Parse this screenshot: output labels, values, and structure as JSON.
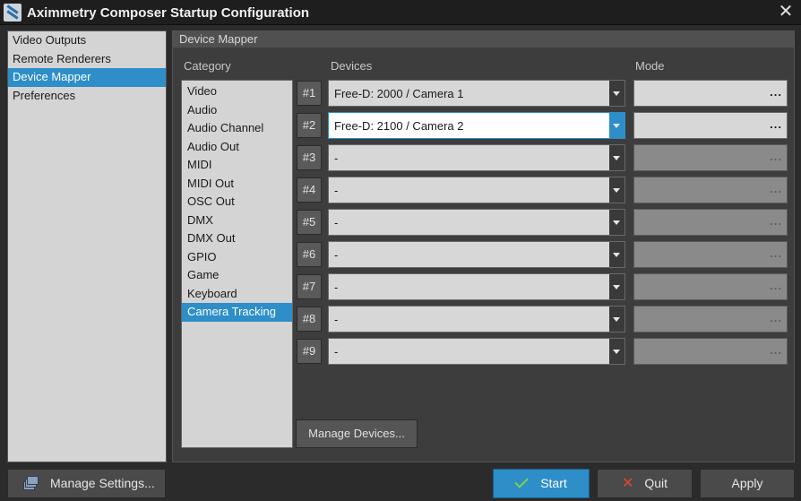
{
  "window": {
    "title": "Aximmetry Composer Startup Configuration"
  },
  "nav": {
    "items": [
      {
        "label": "Video Outputs",
        "selected": false
      },
      {
        "label": "Remote Renderers",
        "selected": false
      },
      {
        "label": "Device Mapper",
        "selected": true
      },
      {
        "label": "Preferences",
        "selected": false
      }
    ]
  },
  "panel": {
    "title": "Device Mapper",
    "category_header": "Category",
    "devices_header": "Devices",
    "mode_header": "Mode",
    "categories": [
      {
        "label": "Video",
        "selected": false
      },
      {
        "label": "Audio",
        "selected": false
      },
      {
        "label": "Audio Channel",
        "selected": false
      },
      {
        "label": "Audio Out",
        "selected": false
      },
      {
        "label": "MIDI",
        "selected": false
      },
      {
        "label": "MIDI Out",
        "selected": false
      },
      {
        "label": "OSC Out",
        "selected": false
      },
      {
        "label": "DMX",
        "selected": false
      },
      {
        "label": "DMX Out",
        "selected": false
      },
      {
        "label": "GPIO",
        "selected": false
      },
      {
        "label": "Game",
        "selected": false
      },
      {
        "label": "Keyboard",
        "selected": false
      },
      {
        "label": "Camera Tracking",
        "selected": true
      }
    ],
    "devices": [
      {
        "num": "#1",
        "value": "Free-D: 2000 / Camera 1",
        "mode": "...",
        "mode_enabled": true,
        "active": false
      },
      {
        "num": "#2",
        "value": "Free-D: 2100 / Camera 2",
        "mode": "...",
        "mode_enabled": true,
        "active": true
      },
      {
        "num": "#3",
        "value": "-",
        "mode": "...",
        "mode_enabled": false,
        "active": false
      },
      {
        "num": "#4",
        "value": "-",
        "mode": "...",
        "mode_enabled": false,
        "active": false
      },
      {
        "num": "#5",
        "value": "-",
        "mode": "...",
        "mode_enabled": false,
        "active": false
      },
      {
        "num": "#6",
        "value": "-",
        "mode": "...",
        "mode_enabled": false,
        "active": false
      },
      {
        "num": "#7",
        "value": "-",
        "mode": "...",
        "mode_enabled": false,
        "active": false
      },
      {
        "num": "#8",
        "value": "-",
        "mode": "...",
        "mode_enabled": false,
        "active": false
      },
      {
        "num": "#9",
        "value": "-",
        "mode": "...",
        "mode_enabled": false,
        "active": false
      }
    ],
    "manage_devices_label": "Manage Devices..."
  },
  "footer": {
    "manage_settings_label": "Manage Settings...",
    "start_label": "Start",
    "quit_label": "Quit",
    "apply_label": "Apply"
  },
  "colors": {
    "accent": "#2d8ec8",
    "quit_icon": "#e8452c",
    "start_icon": "#7fd24a"
  }
}
